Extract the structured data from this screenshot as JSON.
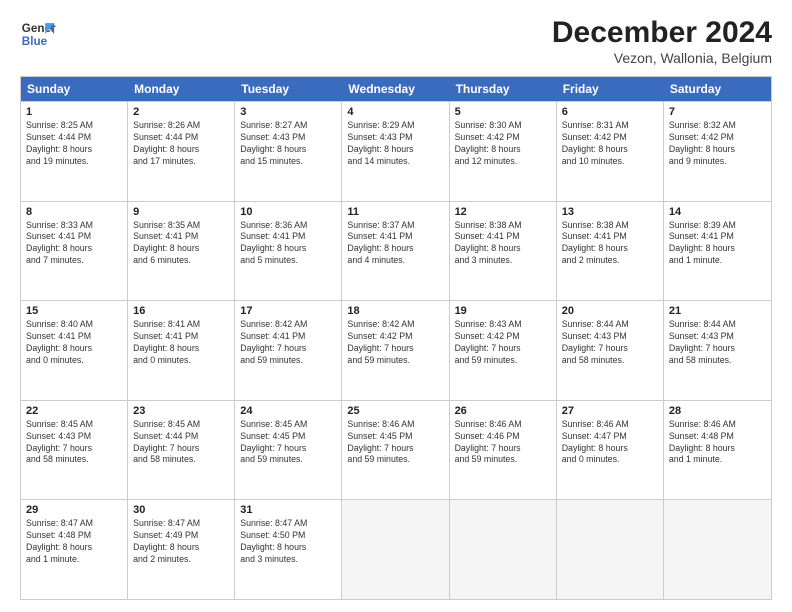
{
  "logo": {
    "line1": "General",
    "line2": "Blue"
  },
  "title": "December 2024",
  "subtitle": "Vezon, Wallonia, Belgium",
  "days": [
    "Sunday",
    "Monday",
    "Tuesday",
    "Wednesday",
    "Thursday",
    "Friday",
    "Saturday"
  ],
  "weeks": [
    [
      {
        "day": "1",
        "lines": [
          "Sunrise: 8:25 AM",
          "Sunset: 4:44 PM",
          "Daylight: 8 hours",
          "and 19 minutes."
        ]
      },
      {
        "day": "2",
        "lines": [
          "Sunrise: 8:26 AM",
          "Sunset: 4:44 PM",
          "Daylight: 8 hours",
          "and 17 minutes."
        ]
      },
      {
        "day": "3",
        "lines": [
          "Sunrise: 8:27 AM",
          "Sunset: 4:43 PM",
          "Daylight: 8 hours",
          "and 15 minutes."
        ]
      },
      {
        "day": "4",
        "lines": [
          "Sunrise: 8:29 AM",
          "Sunset: 4:43 PM",
          "Daylight: 8 hours",
          "and 14 minutes."
        ]
      },
      {
        "day": "5",
        "lines": [
          "Sunrise: 8:30 AM",
          "Sunset: 4:42 PM",
          "Daylight: 8 hours",
          "and 12 minutes."
        ]
      },
      {
        "day": "6",
        "lines": [
          "Sunrise: 8:31 AM",
          "Sunset: 4:42 PM",
          "Daylight: 8 hours",
          "and 10 minutes."
        ]
      },
      {
        "day": "7",
        "lines": [
          "Sunrise: 8:32 AM",
          "Sunset: 4:42 PM",
          "Daylight: 8 hours",
          "and 9 minutes."
        ]
      }
    ],
    [
      {
        "day": "8",
        "lines": [
          "Sunrise: 8:33 AM",
          "Sunset: 4:41 PM",
          "Daylight: 8 hours",
          "and 7 minutes."
        ]
      },
      {
        "day": "9",
        "lines": [
          "Sunrise: 8:35 AM",
          "Sunset: 4:41 PM",
          "Daylight: 8 hours",
          "and 6 minutes."
        ]
      },
      {
        "day": "10",
        "lines": [
          "Sunrise: 8:36 AM",
          "Sunset: 4:41 PM",
          "Daylight: 8 hours",
          "and 5 minutes."
        ]
      },
      {
        "day": "11",
        "lines": [
          "Sunrise: 8:37 AM",
          "Sunset: 4:41 PM",
          "Daylight: 8 hours",
          "and 4 minutes."
        ]
      },
      {
        "day": "12",
        "lines": [
          "Sunrise: 8:38 AM",
          "Sunset: 4:41 PM",
          "Daylight: 8 hours",
          "and 3 minutes."
        ]
      },
      {
        "day": "13",
        "lines": [
          "Sunrise: 8:38 AM",
          "Sunset: 4:41 PM",
          "Daylight: 8 hours",
          "and 2 minutes."
        ]
      },
      {
        "day": "14",
        "lines": [
          "Sunrise: 8:39 AM",
          "Sunset: 4:41 PM",
          "Daylight: 8 hours",
          "and 1 minute."
        ]
      }
    ],
    [
      {
        "day": "15",
        "lines": [
          "Sunrise: 8:40 AM",
          "Sunset: 4:41 PM",
          "Daylight: 8 hours",
          "and 0 minutes."
        ]
      },
      {
        "day": "16",
        "lines": [
          "Sunrise: 8:41 AM",
          "Sunset: 4:41 PM",
          "Daylight: 8 hours",
          "and 0 minutes."
        ]
      },
      {
        "day": "17",
        "lines": [
          "Sunrise: 8:42 AM",
          "Sunset: 4:41 PM",
          "Daylight: 7 hours",
          "and 59 minutes."
        ]
      },
      {
        "day": "18",
        "lines": [
          "Sunrise: 8:42 AM",
          "Sunset: 4:42 PM",
          "Daylight: 7 hours",
          "and 59 minutes."
        ]
      },
      {
        "day": "19",
        "lines": [
          "Sunrise: 8:43 AM",
          "Sunset: 4:42 PM",
          "Daylight: 7 hours",
          "and 59 minutes."
        ]
      },
      {
        "day": "20",
        "lines": [
          "Sunrise: 8:44 AM",
          "Sunset: 4:43 PM",
          "Daylight: 7 hours",
          "and 58 minutes."
        ]
      },
      {
        "day": "21",
        "lines": [
          "Sunrise: 8:44 AM",
          "Sunset: 4:43 PM",
          "Daylight: 7 hours",
          "and 58 minutes."
        ]
      }
    ],
    [
      {
        "day": "22",
        "lines": [
          "Sunrise: 8:45 AM",
          "Sunset: 4:43 PM",
          "Daylight: 7 hours",
          "and 58 minutes."
        ]
      },
      {
        "day": "23",
        "lines": [
          "Sunrise: 8:45 AM",
          "Sunset: 4:44 PM",
          "Daylight: 7 hours",
          "and 58 minutes."
        ]
      },
      {
        "day": "24",
        "lines": [
          "Sunrise: 8:45 AM",
          "Sunset: 4:45 PM",
          "Daylight: 7 hours",
          "and 59 minutes."
        ]
      },
      {
        "day": "25",
        "lines": [
          "Sunrise: 8:46 AM",
          "Sunset: 4:45 PM",
          "Daylight: 7 hours",
          "and 59 minutes."
        ]
      },
      {
        "day": "26",
        "lines": [
          "Sunrise: 8:46 AM",
          "Sunset: 4:46 PM",
          "Daylight: 7 hours",
          "and 59 minutes."
        ]
      },
      {
        "day": "27",
        "lines": [
          "Sunrise: 8:46 AM",
          "Sunset: 4:47 PM",
          "Daylight: 8 hours",
          "and 0 minutes."
        ]
      },
      {
        "day": "28",
        "lines": [
          "Sunrise: 8:46 AM",
          "Sunset: 4:48 PM",
          "Daylight: 8 hours",
          "and 1 minute."
        ]
      }
    ],
    [
      {
        "day": "29",
        "lines": [
          "Sunrise: 8:47 AM",
          "Sunset: 4:48 PM",
          "Daylight: 8 hours",
          "and 1 minute."
        ]
      },
      {
        "day": "30",
        "lines": [
          "Sunrise: 8:47 AM",
          "Sunset: 4:49 PM",
          "Daylight: 8 hours",
          "and 2 minutes."
        ]
      },
      {
        "day": "31",
        "lines": [
          "Sunrise: 8:47 AM",
          "Sunset: 4:50 PM",
          "Daylight: 8 hours",
          "and 3 minutes."
        ]
      },
      null,
      null,
      null,
      null
    ]
  ]
}
